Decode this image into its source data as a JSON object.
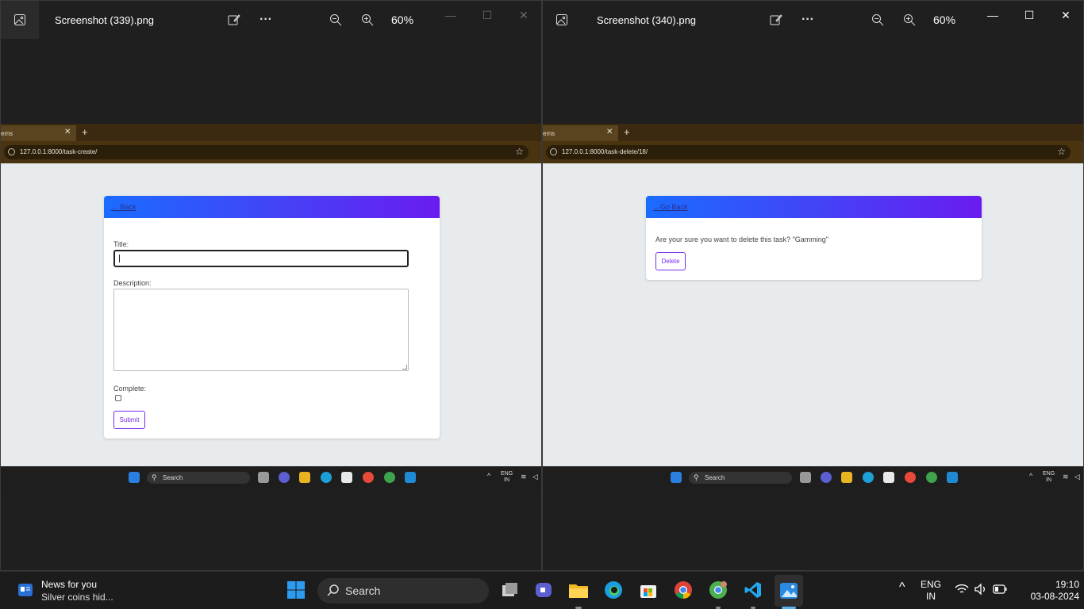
{
  "left_window": {
    "filename": "Screenshot (339).png",
    "zoom": "60%",
    "tab_label": "ems",
    "new_tab": "+",
    "url": "127.0.0.1:8000/task-create/",
    "form": {
      "back_link": "← Back",
      "title_label": "Title:",
      "title_value": "",
      "description_label": "Description:",
      "complete_label": "Complete:",
      "complete_checked": false,
      "submit_label": "Submit"
    }
  },
  "right_window": {
    "filename": "Screenshot (340).png",
    "zoom": "60%",
    "tab_label": "ems",
    "new_tab": "+",
    "url": "127.0.0.1:8000/task-delete/18/",
    "confirm": {
      "back_link": "←Go Back",
      "message": "Are your sure you want to delete this task? \"Gamming\"",
      "delete_label": "Delete"
    }
  },
  "inner_taskbar": {
    "search_label": "Search",
    "lang_line1": "ENG",
    "lang_line2": "IN"
  },
  "taskbar": {
    "news_title": "News for you",
    "news_subtitle": "Silver coins hid...",
    "search_label": "Search",
    "lang_line1": "ENG",
    "lang_line2": "IN",
    "time": "19:10",
    "date": "03-08-2024"
  },
  "colors": {
    "header_gradient_start": "#1a6cff",
    "header_gradient_end": "#6a1cf0",
    "button_accent": "#7a2cf0",
    "browser_frame": "#4a3410"
  }
}
